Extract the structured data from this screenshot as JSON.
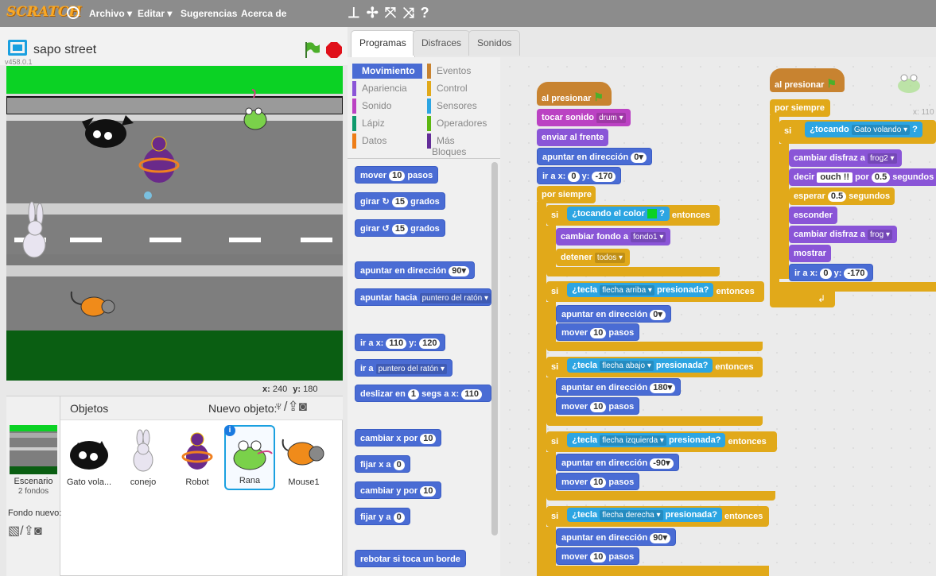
{
  "menu": {
    "logo": "SCRATCH",
    "items": [
      "Archivo ▾",
      "Editar ▾",
      "Sugerencias",
      "Acerca de"
    ]
  },
  "stage": {
    "title": "sapo street",
    "version": "v458.0.1",
    "x_label": "x:",
    "x_value": "240",
    "y_label": "y:",
    "y_value": "180"
  },
  "sprites": {
    "header": "Objetos",
    "new_sprite": "Nuevo objeto:",
    "stage_label": "Escenario",
    "stage_count": "2 fondos",
    "new_backdrop": "Fondo nuevo:",
    "items": [
      "Gato vola...",
      "conejo",
      "Robot",
      "Rana",
      "Mouse1"
    ],
    "selected": "Rana"
  },
  "tabs": [
    "Programas",
    "Disfraces",
    "Sonidos"
  ],
  "categories": {
    "left": [
      "Movimiento",
      "Apariencia",
      "Sonido",
      "Lápiz",
      "Datos"
    ],
    "right": [
      "Eventos",
      "Control",
      "Sensores",
      "Operadores",
      "Más Bloques"
    ],
    "colors_left": [
      "#4a6cd4",
      "#8a55d7",
      "#bb42c3",
      "#0e9a6c",
      "#ee7d16"
    ],
    "colors_right": [
      "#c88330",
      "#e1a91a",
      "#2ca5e2",
      "#5cb712",
      "#632d99"
    ]
  },
  "palette": {
    "move": "mover",
    "move_n": "10",
    "steps": "pasos",
    "turn_r": "girar",
    "turn_r_n": "15",
    "degrees": "grados",
    "turn_l": "girar",
    "turn_l_n": "15",
    "point_dir": "apuntar en dirección",
    "point_dir_n": "90▾",
    "point_to": "apuntar hacia",
    "point_to_v": "puntero del ratón ▾",
    "goto_xy": "ir a x:",
    "goto_x": "110",
    "y": "y:",
    "goto_y": "120",
    "goto": "ir a",
    "goto_v": "puntero del ratón ▾",
    "glide": "deslizar en",
    "glide_n": "1",
    "glide_segs": "segs a x:",
    "glide_x": "110",
    "change_x": "cambiar x por",
    "change_x_n": "10",
    "set_x": "fijar x a",
    "set_x_n": "0",
    "change_y": "cambiar y por",
    "change_y_n": "10",
    "set_y": "fijar y a",
    "set_y_n": "0",
    "bounce": "rebotar si toca un borde"
  },
  "script1": {
    "hat": "al presionar",
    "sound": "tocar sonido",
    "sound_v": "drum ▾",
    "front": "enviar al frente",
    "dir": "apuntar en dirección",
    "dir_v": "0▾",
    "goto": "ir a x:",
    "goto_x": "0",
    "goto_y_l": "y:",
    "goto_y": "-170",
    "forever": "por siempre",
    "if": "si",
    "touch_color": "¿tocando el color",
    "q": "?",
    "then": "entonces",
    "backdrop": "cambiar fondo a",
    "backdrop_v": "fondo1 ▾",
    "stop": "detener",
    "stop_v": "todos ▾",
    "key_up": "¿tecla",
    "key_up_v": "flecha arriba ▾",
    "pressed": "presionada?",
    "dir_up": "0▾",
    "move": "mover",
    "move_n": "10",
    "steps": "pasos",
    "key_down_v": "flecha abajo ▾",
    "dir_down": "180▾",
    "key_left_v": "flecha izquierda ▾",
    "dir_left": "-90▾",
    "key_right_v": "flecha derecha ▾",
    "dir_right": "90▾"
  },
  "script2": {
    "hat": "al presionar",
    "forever": "por siempre",
    "if": "si",
    "touching": "¿tocando",
    "touching_v": "Gato volando ▾",
    "q": "?",
    "costume": "cambiar disfraz a",
    "costume_v": "frog2 ▾",
    "say": "decir",
    "say_v": "ouch !!",
    "say_for": "por",
    "say_n": "0.5",
    "secs": "segundos",
    "wait": "esperar",
    "wait_n": "0.5",
    "hide": "esconder",
    "costume2_v": "frog ▾",
    "show": "mostrar",
    "goto": "ir a x:",
    "goto_x": "0",
    "goto_y_l": "y:",
    "goto_y": "-170",
    "sprite_x": "x: 110"
  }
}
